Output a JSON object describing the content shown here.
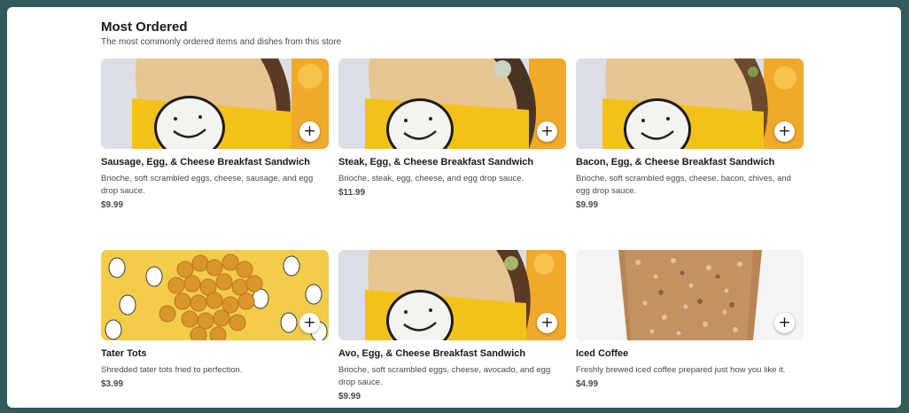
{
  "section": {
    "title": "Most Ordered",
    "subtitle": "The most commonly ordered items and dishes from this store"
  },
  "add_button_glyph": "+",
  "items": [
    {
      "name": "Sausage, Egg, & Cheese Breakfast Sandwich",
      "description": "Brioche, soft scrambled eggs, cheese, sausage, and egg drop sauce.",
      "price": "$9.99",
      "image_icon": "sandwich-photo"
    },
    {
      "name": "Steak, Egg, & Cheese Breakfast Sandwich",
      "description": "Brioche, steak, egg, cheese, and egg drop sauce.",
      "price": "$11.99",
      "image_icon": "sandwich-photo"
    },
    {
      "name": "Bacon, Egg, & Cheese Breakfast Sandwich",
      "description": "Brioche, soft scrambled eggs, cheese, bacon, chives, and egg drop sauce.",
      "price": "$9.99",
      "image_icon": "sandwich-photo"
    },
    {
      "name": "Tater Tots",
      "description": "Shredded tater tots fried to perfection.",
      "price": "$3.99",
      "image_icon": "tater-tots-photo"
    },
    {
      "name": "Avo, Egg, & Cheese Breakfast Sandwich",
      "description": "Brioche, soft scrambled eggs, cheese, avocado, and egg drop sauce.",
      "price": "$9.99",
      "image_icon": "sandwich-photo"
    },
    {
      "name": "Iced Coffee",
      "description": "Freshly brewed iced coffee prepared just how you like it.",
      "price": "$4.99",
      "image_icon": "iced-coffee-photo"
    }
  ],
  "colors": {
    "page_background": "#2f5b5c",
    "card_background": "#ffffff",
    "text_primary": "#191919",
    "text_secondary": "#494949",
    "sandwich_yellow": "#f2c21a",
    "bread": "#e9c48a"
  }
}
